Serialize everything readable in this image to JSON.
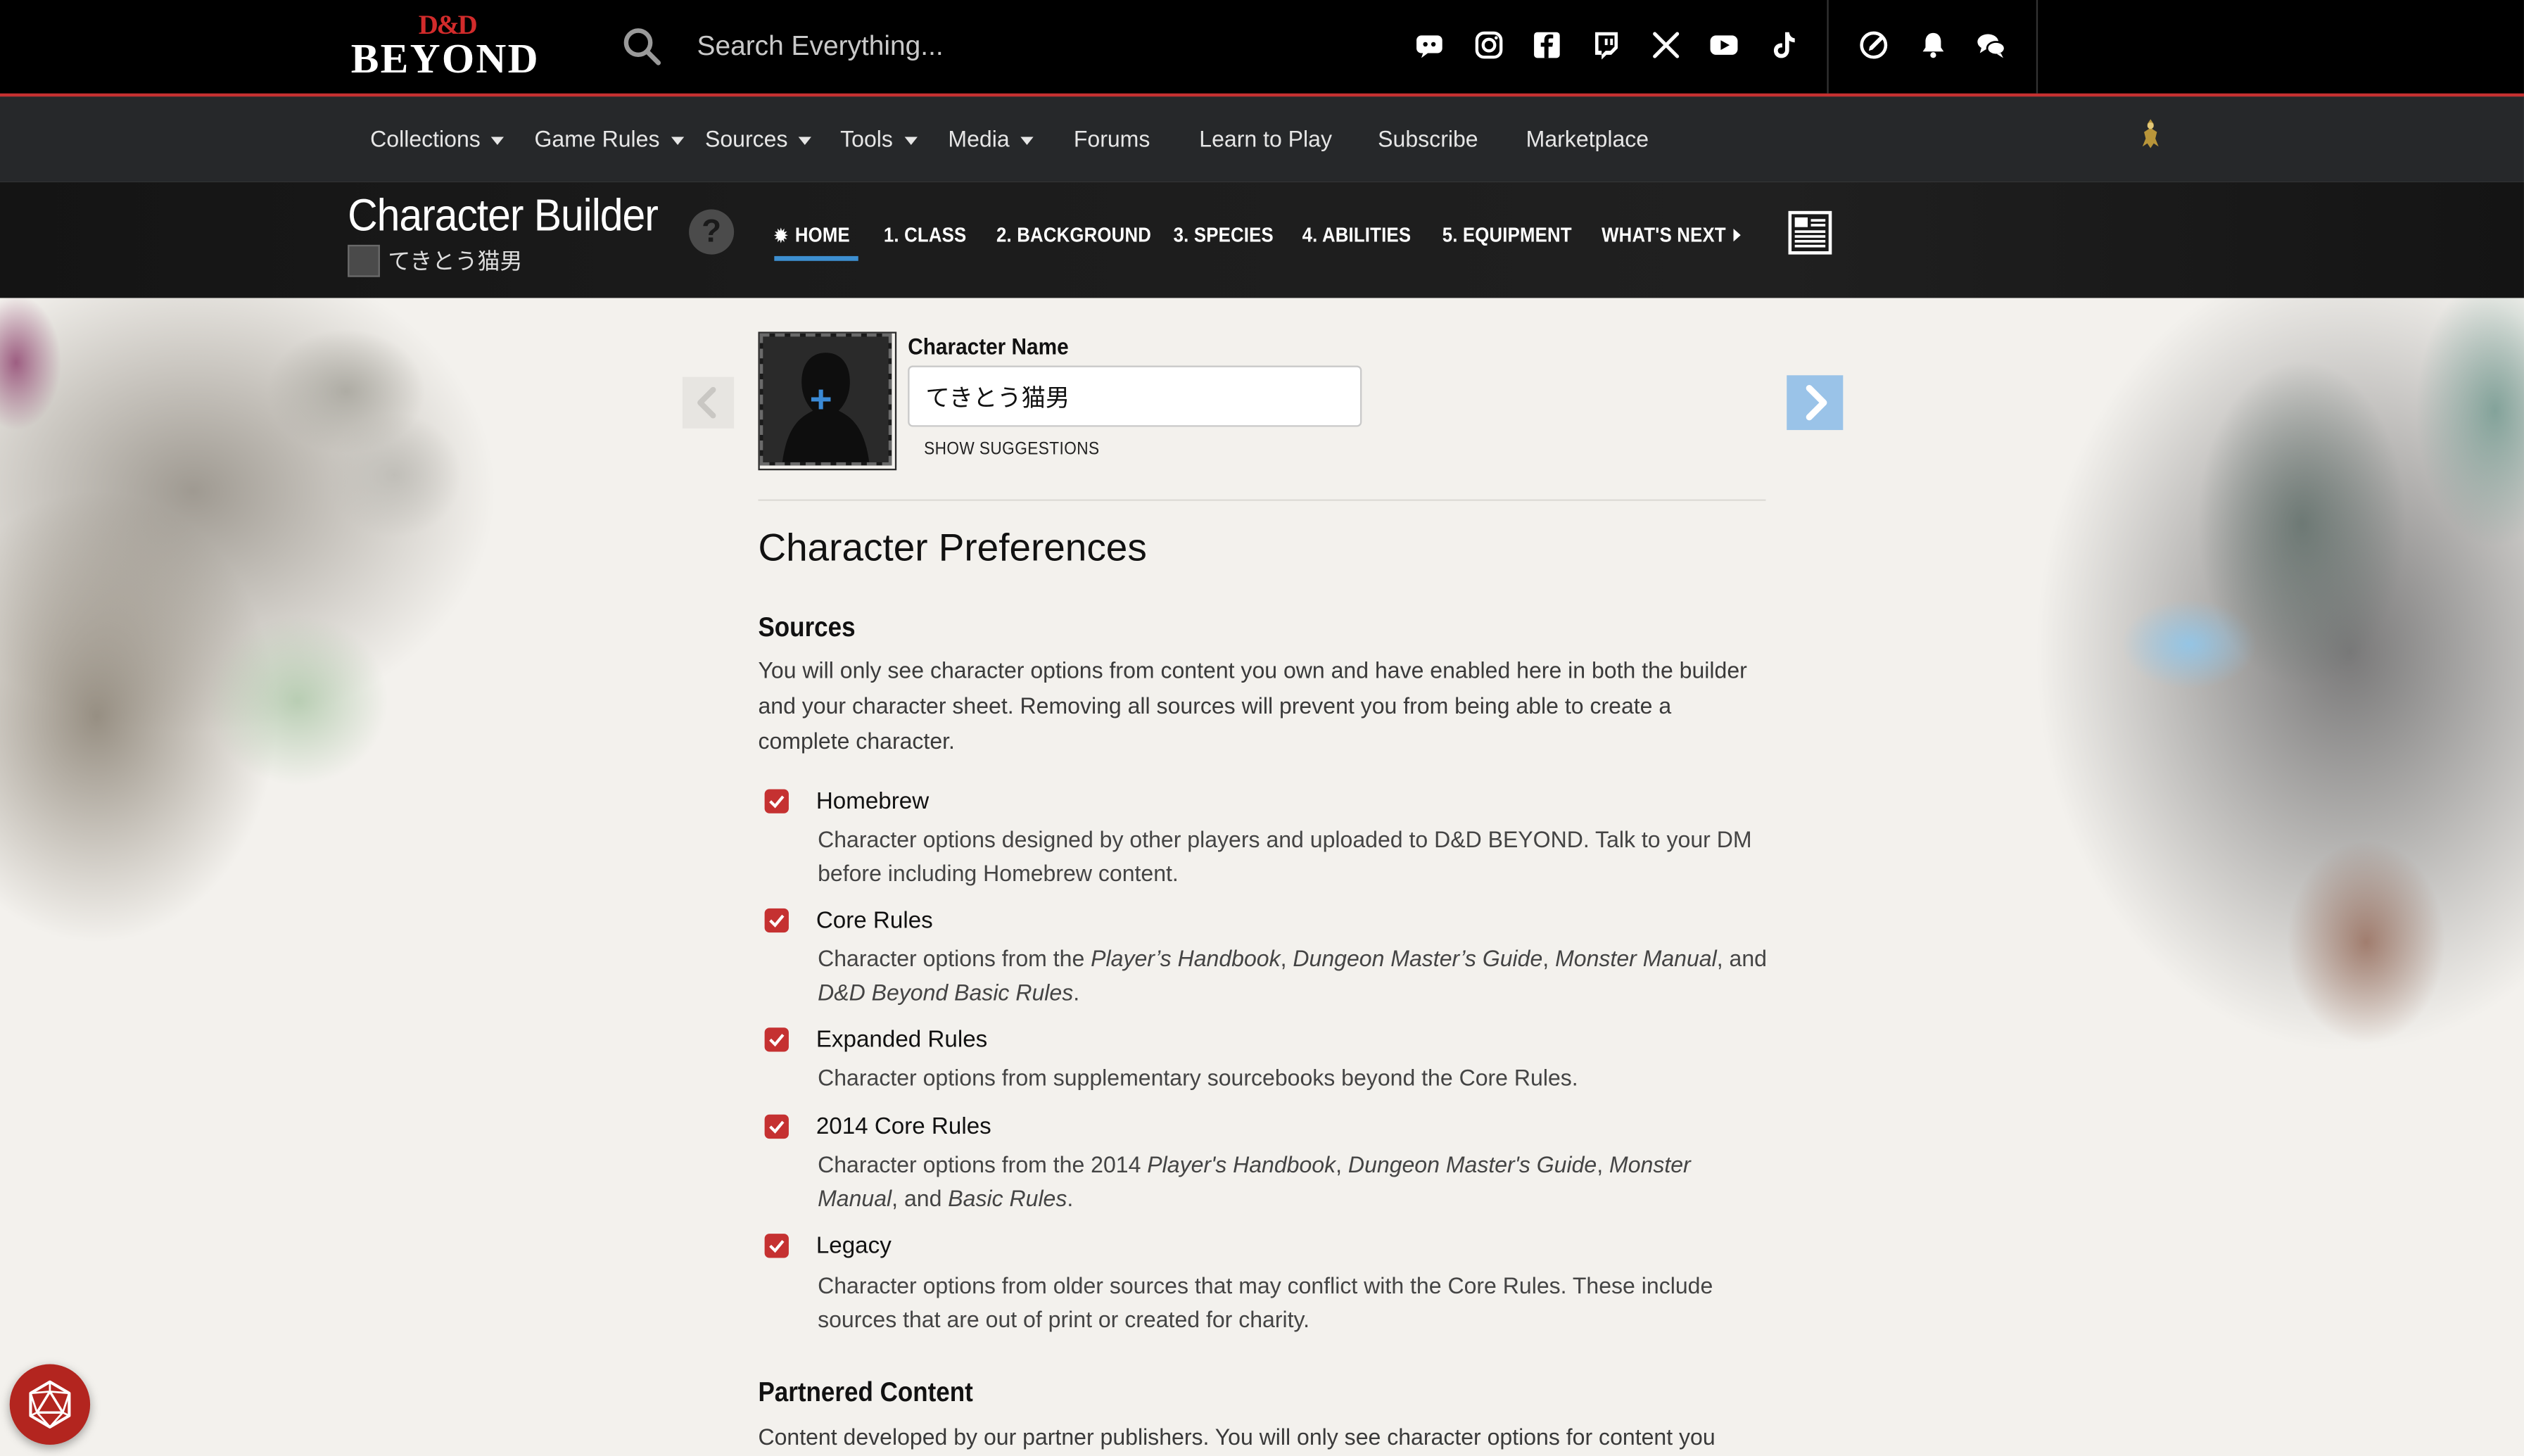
{
  "header": {
    "logo_top": "D&D",
    "logo_bottom": "BEYOND",
    "search_placeholder": "Search Everything...",
    "social_icons": [
      "discord-icon",
      "instagram-icon",
      "facebook-icon",
      "twitch-icon",
      "x-icon",
      "youtube-icon",
      "tiktok-icon"
    ],
    "utility_icons": [
      "edit-icon",
      "bell-icon",
      "chat-icon"
    ]
  },
  "nav": {
    "items": [
      {
        "label": "Collections",
        "dropdown": true
      },
      {
        "label": "Game Rules",
        "dropdown": true
      },
      {
        "label": "Sources",
        "dropdown": true
      },
      {
        "label": "Tools",
        "dropdown": true
      },
      {
        "label": "Media",
        "dropdown": true
      },
      {
        "label": "Forums",
        "dropdown": false
      },
      {
        "label": "Learn to Play",
        "dropdown": false
      },
      {
        "label": "Subscribe",
        "dropdown": false
      },
      {
        "label": "Marketplace",
        "dropdown": false
      }
    ]
  },
  "builder": {
    "title": "Character Builder",
    "character_name": "てきとう猫男",
    "help_label": "?",
    "steps": [
      {
        "label": "HOME",
        "active": true
      },
      {
        "label": "1. CLASS",
        "active": false
      },
      {
        "label": "2. BACKGROUND",
        "active": false
      },
      {
        "label": "3. SPECIES",
        "active": false
      },
      {
        "label": "4. ABILITIES",
        "active": false
      },
      {
        "label": "5. EQUIPMENT",
        "active": false
      },
      {
        "label": "WHAT'S NEXT",
        "active": false
      }
    ]
  },
  "main": {
    "name_label": "Character Name",
    "name_value": "てきとう猫男",
    "suggestions_label": "SHOW SUGGESTIONS",
    "preferences_title": "Character Preferences",
    "sources_title": "Sources",
    "sources_text": "You will only see character options from content you own and have enabled here in both the builder and your character sheet. Removing all sources will prevent you from being able to create a complete character.",
    "options": [
      {
        "title": "Homebrew",
        "checked": true,
        "desc": "Character options designed by other players and uploaded to D&D BEYOND. Talk to your DM before including Homebrew content."
      },
      {
        "title": "Core Rules",
        "checked": true,
        "desc_pre": "Character options from the ",
        "desc_books": [
          "Player’s Handbook",
          "Dungeon Master’s Guide",
          "Monster Manual",
          "D&D Beyond Basic Rules"
        ]
      },
      {
        "title": "Expanded Rules",
        "checked": true,
        "desc": "Character options from supplementary sourcebooks beyond the Core Rules."
      },
      {
        "title": "2014 Core Rules",
        "checked": true,
        "desc_pre": "Character options from the 2014 ",
        "desc_books": [
          "Player's Handbook",
          "Dungeon Master's Guide",
          "Monster Manual",
          "Basic Rules"
        ]
      },
      {
        "title": "Legacy",
        "checked": true,
        "desc": "Character options from older sources that may conflict with the Core Rules. These include sources that are out of print or created for charity."
      }
    ],
    "partnered_title": "Partnered Content",
    "partnered_text": "Content developed by our partner publishers. You will only see character options for content you"
  },
  "colors": {
    "accent_red": "#c53131",
    "active_tab_blue": "#3d8fd0",
    "next_button_blue": "#9ac3e8",
    "topbar": "#000000",
    "navbar": "#26282a"
  }
}
